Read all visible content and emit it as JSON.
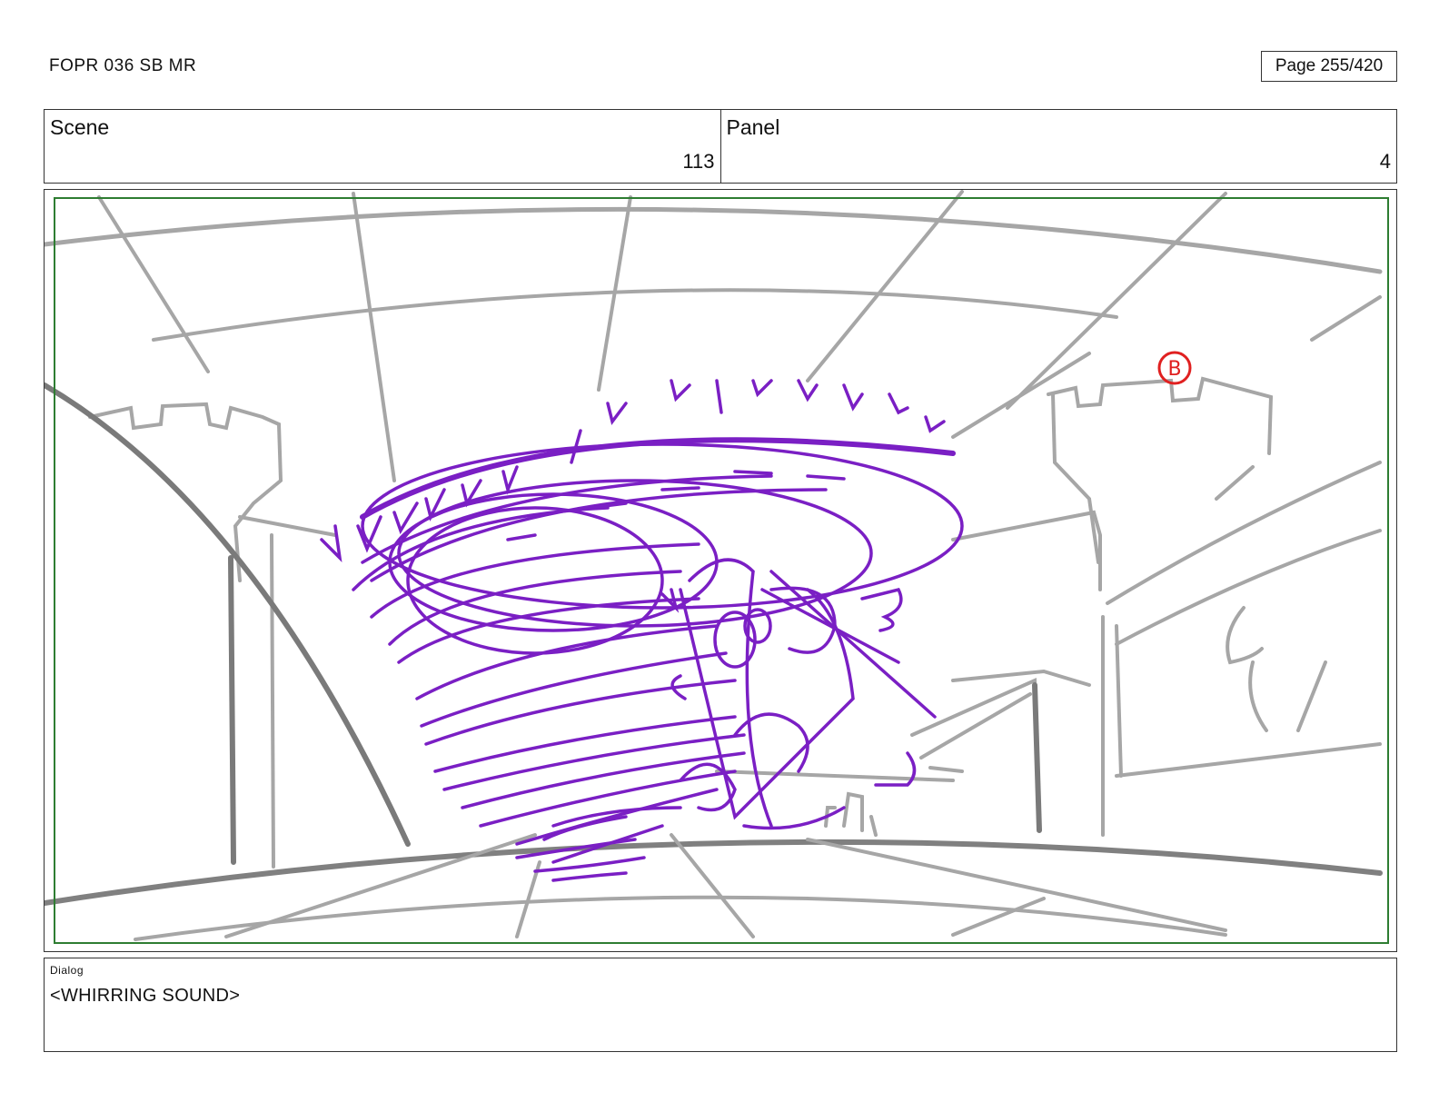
{
  "header": {
    "doc_title": "FOPR 036 SB MR",
    "page_label": "Page 255/420"
  },
  "info": {
    "scene_label": "Scene",
    "scene_value": "113",
    "panel_label": "Panel",
    "panel_value": "4"
  },
  "panel": {
    "marker_letter": "B",
    "colors": {
      "background_lines": "#a6a6a6",
      "action_lines": "#7a1fc4",
      "marker": "#e02020",
      "safe_frame": "#2e7d32"
    }
  },
  "dialog": {
    "label": "Dialog",
    "text": "<WHIRRING SOUND>"
  }
}
